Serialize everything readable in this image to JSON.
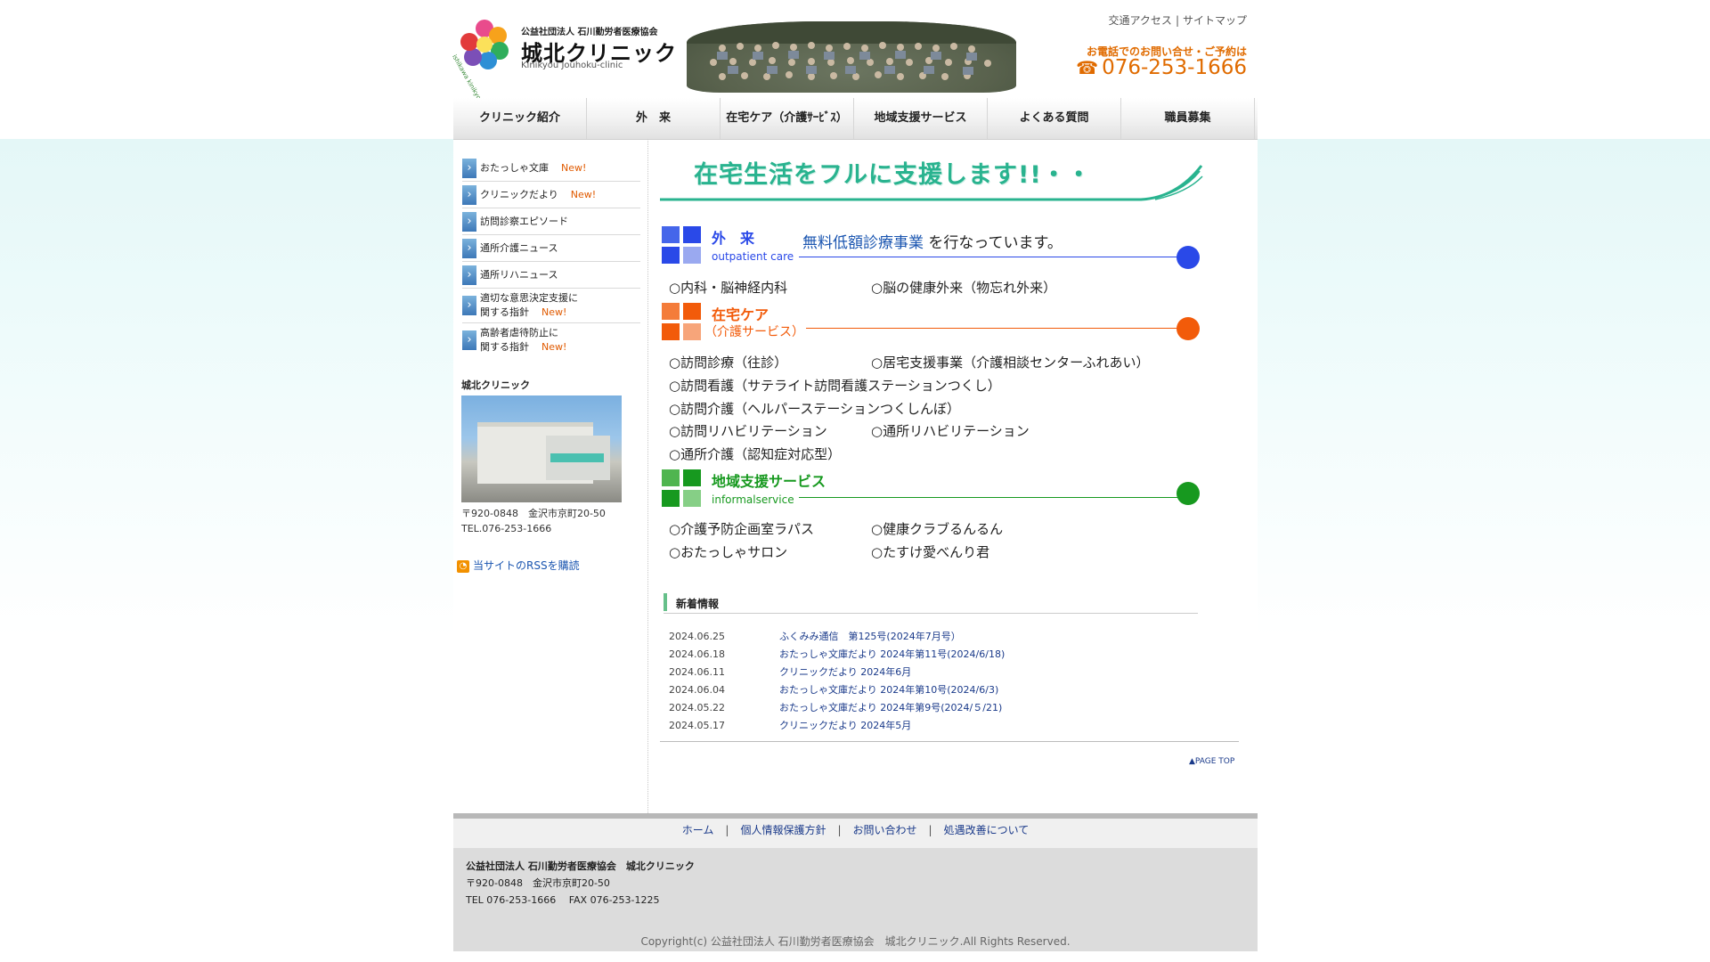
{
  "header": {
    "org": "公益社団法人 石川勤労者医療協会",
    "clinic_name": "城北クリニック",
    "clinic_roman": "Kinikyou Jouhoku-clinic",
    "logo_vertical": "ishikawa kinikyo",
    "top_links": [
      "交通アクセス",
      "サイトマップ"
    ],
    "phone_caption": "お電話でのお問い合せ・ご予約は",
    "phone": "076-253-1666"
  },
  "nav": [
    "クリニック紹介",
    "外　来",
    "在宅ケア（介護ｻｰﾋﾞｽ）",
    "地域支援サービス",
    "よくある質問",
    "職員募集"
  ],
  "sidebar": {
    "menu": [
      {
        "label": "おたっしゃ文庫",
        "new": "New!"
      },
      {
        "label": "クリニックだより",
        "new": "New!"
      },
      {
        "label": "訪問診察エピソード",
        "new": ""
      },
      {
        "label": "通所介護ニュース",
        "new": ""
      },
      {
        "label": "通所リハニュース",
        "new": ""
      },
      {
        "label": "適切な意思決定支援に",
        "label2": "関する指針",
        "new": "New!"
      },
      {
        "label": "高齢者虐待防止に",
        "label2": "関する指針",
        "new": "New!"
      }
    ],
    "clinic_title": "城北クリニック",
    "address": "〒920-0848　金沢市京町20-50",
    "tel": "TEL.076-253-1666",
    "rss": "当サイトのRSSを購読"
  },
  "main": {
    "banner": "在宅生活をフルに支援します!!・・",
    "outpatient": {
      "title": "外　来",
      "subtitle": "outpatient care",
      "free_care_highlight": "無料低額診療事業",
      "free_care_rest": " を行なっています。",
      "items": [
        "○内科・脳神経内科",
        "○脳の健康外来（物忘れ外来）"
      ]
    },
    "homecare": {
      "title": "在宅ケア",
      "subtitle": "（介護サービス）",
      "items": [
        "○訪問診療（往診）",
        "○居宅支援事業（介護相談センターふれあい）",
        "○訪問看護（サテライト訪問看護ステーションつくし）",
        "○訪問介護（ヘルパーステーションつくしんぼ）",
        "○訪問リハビリテーション",
        "○通所リハビリテーション",
        "○通所介護（認知症対応型）"
      ]
    },
    "community": {
      "title": "地域支援サービス",
      "subtitle": "informalservice",
      "items": [
        "○介護予防企画室ラパス",
        "○健康クラブるんるん",
        "○おたっしゃサロン",
        "○たすけ愛べんり君"
      ]
    },
    "news": {
      "heading": "新着情報",
      "rows": [
        {
          "date": "2024.06.25",
          "title": "ふくみみ通信　第125号(2024年7月号）"
        },
        {
          "date": "2024.06.18",
          "title": "おたっしゃ文庫だより 2024年第11号(2024/6/18)"
        },
        {
          "date": "2024.06.11",
          "title": "クリニックだより 2024年6月"
        },
        {
          "date": "2024.06.04",
          "title": "おたっしゃ文庫だより 2024年第10号(2024/6/3)"
        },
        {
          "date": "2024.05.22",
          "title": "おたっしゃ文庫だより 2024年第9号(2024/５/21)"
        },
        {
          "date": "2024.05.17",
          "title": "クリニックだより 2024年5月"
        }
      ]
    },
    "pagetop": "▲PAGE TOP"
  },
  "footer": {
    "links": [
      "ホーム",
      "個人情報保護方針",
      "お問い合わせ",
      "処遇改善について"
    ],
    "org": "公益社団法人 石川勤労者医療協会　城北クリニック",
    "address": "〒920-0848　金沢市京町20-50",
    "telfax": "TEL 076-253-1666　 FAX 076-253-1225",
    "copyright": "Copyright(c) 公益社団法人 石川勤労者医療協会　城北クリニック.All Rights Reserved."
  },
  "colors": {
    "outpatient": "#2a49e8",
    "homecare": "#f25b0a",
    "community": "#17991f",
    "banner": "#29b38f",
    "link": "#1a55b0",
    "new": "#e05a00"
  }
}
